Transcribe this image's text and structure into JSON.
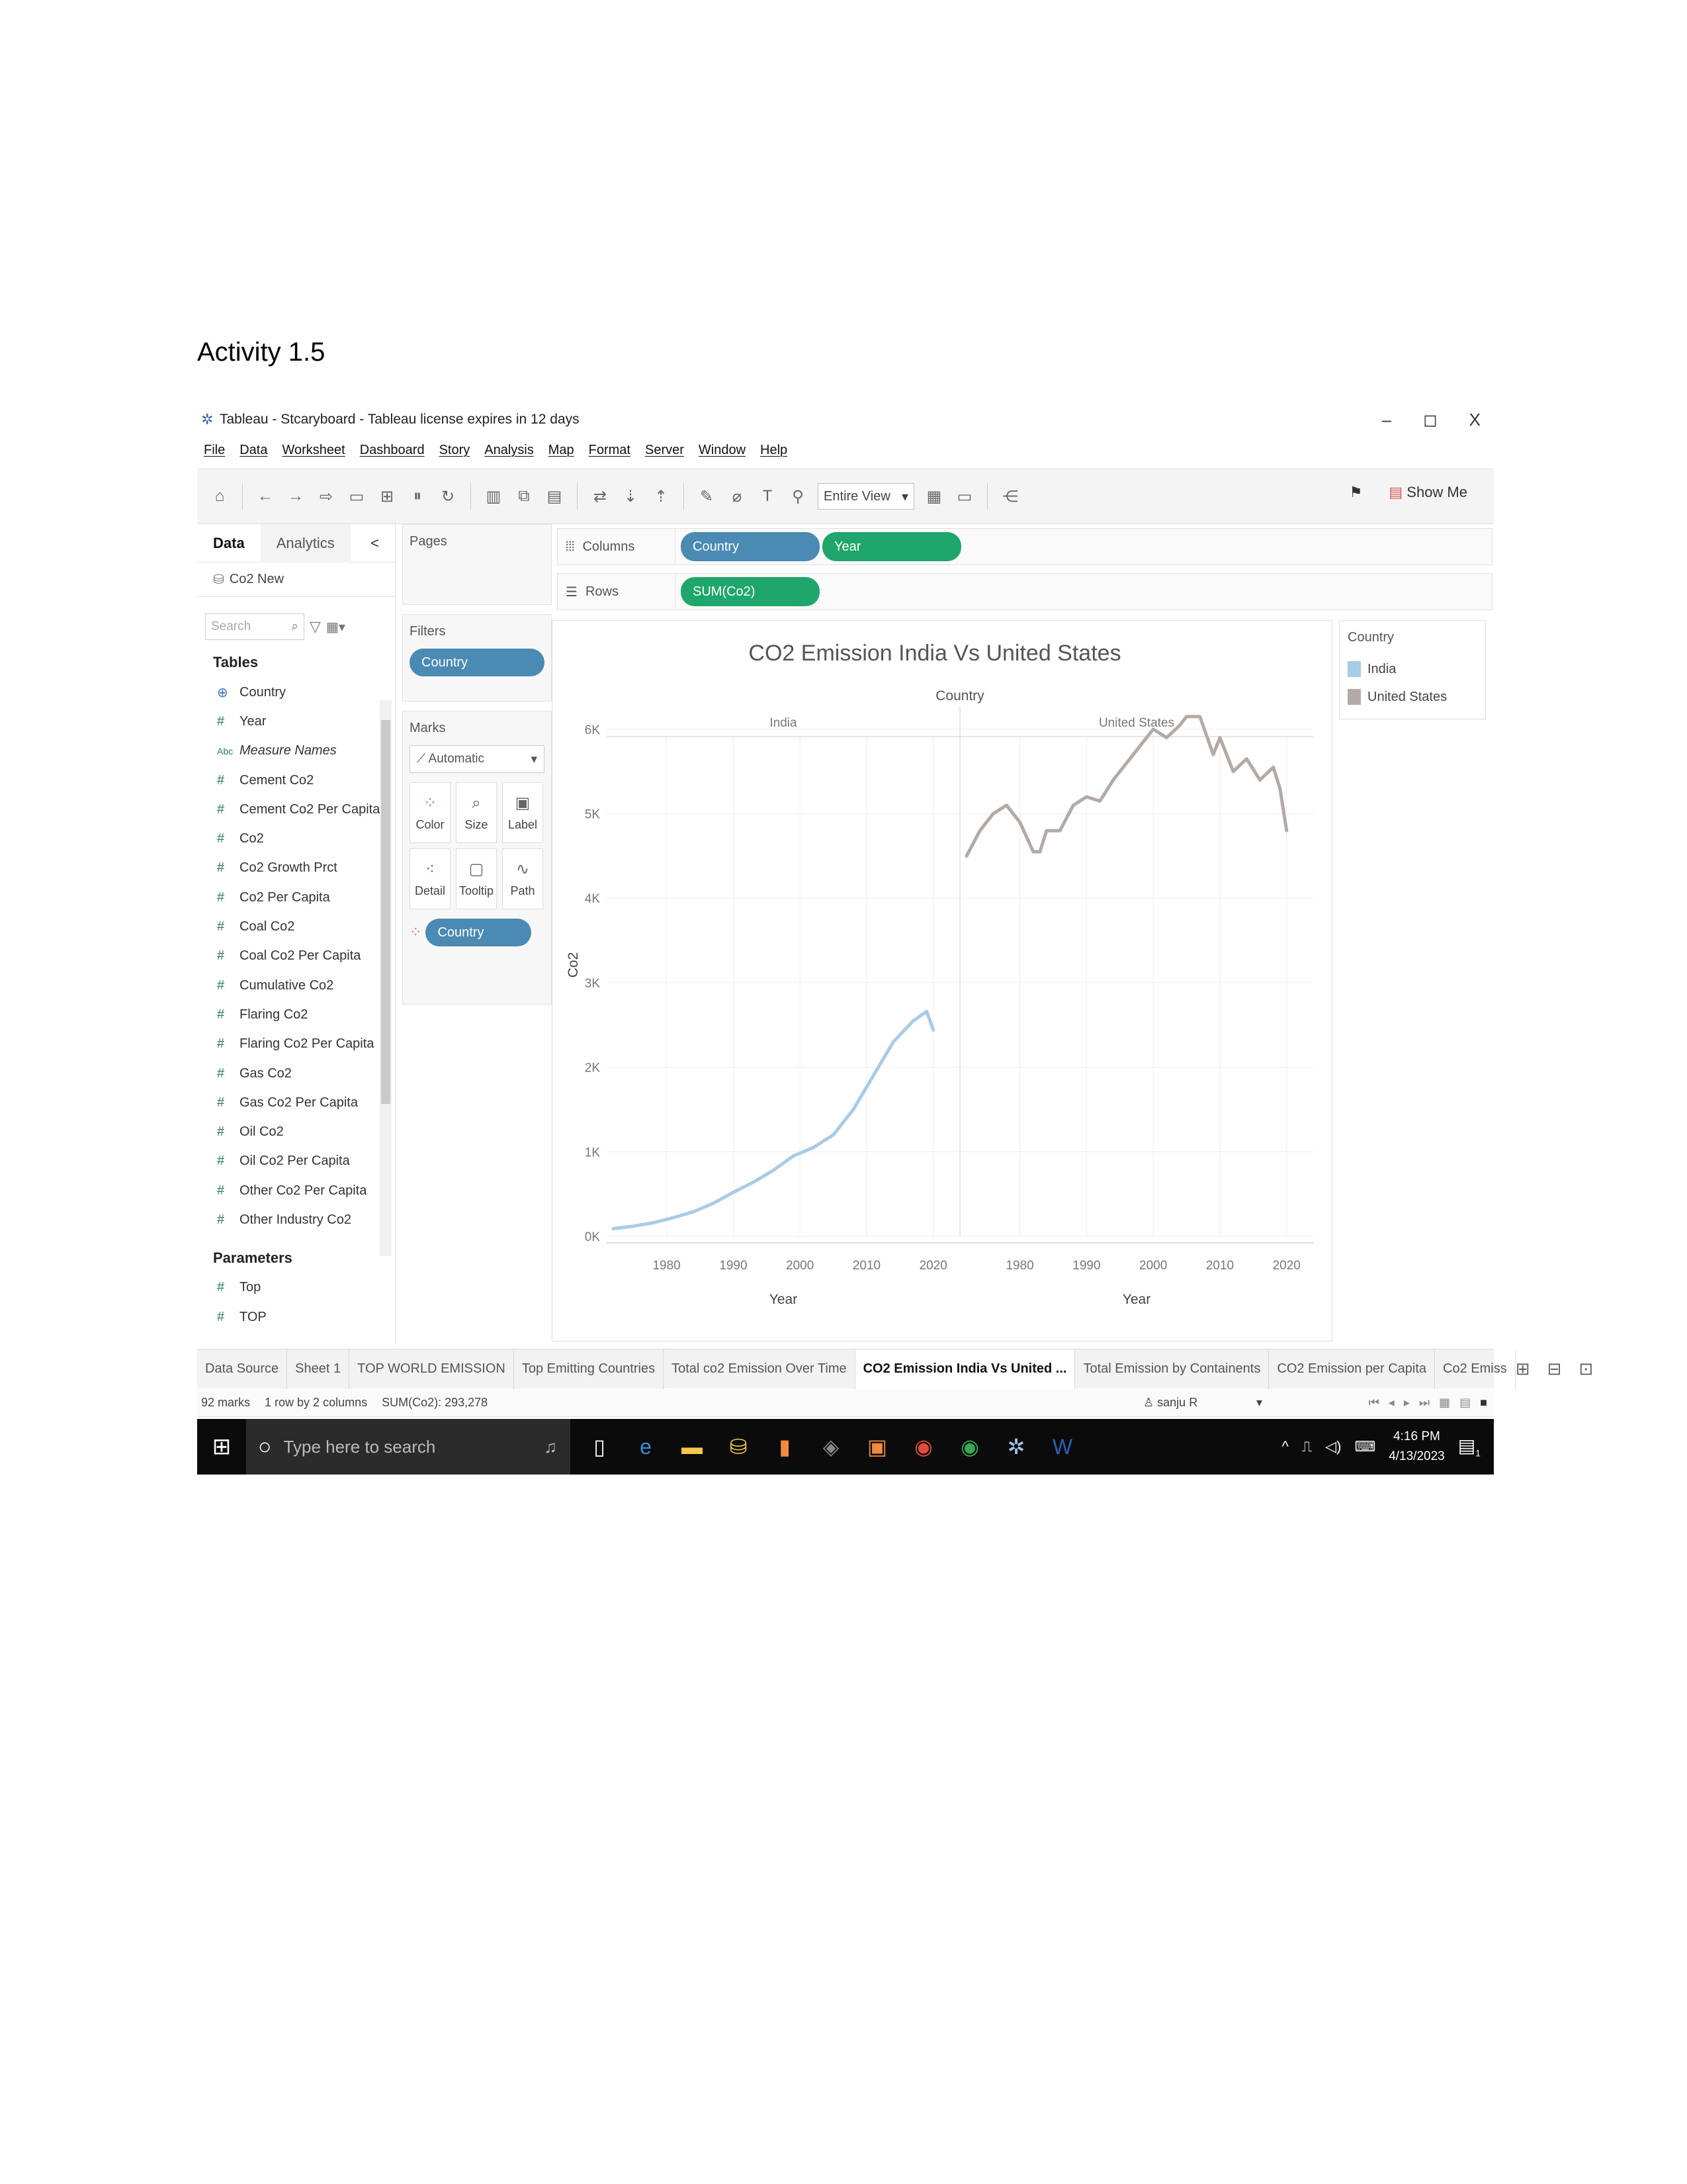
{
  "document": {
    "heading": "Activity 1.5"
  },
  "window": {
    "title": "Tableau - Stcaryboard - Tableau license expires in 12 days",
    "controls": [
      "–",
      "◻",
      "X"
    ]
  },
  "menu": [
    "File",
    "Data",
    "Worksheet",
    "Dashboard",
    "Story",
    "Analysis",
    "Map",
    "Format",
    "Server",
    "Window",
    "Help"
  ],
  "toolbar": {
    "view_select": "Entire View",
    "show_me": "Show Me"
  },
  "data_pane": {
    "tab_data": "Data",
    "tab_analytics": "Analytics",
    "collapse": "<",
    "datasource": "Co2 New",
    "search_placeholder": "Search",
    "tables_label": "Tables",
    "fields": [
      {
        "type": "⊕",
        "name": "Country"
      },
      {
        "type": "#",
        "name": "Year"
      },
      {
        "type": "Abc",
        "name": "Measure Names"
      },
      {
        "type": "#",
        "name": "Cement Co2"
      },
      {
        "type": "#",
        "name": "Cement Co2 Per Capita"
      },
      {
        "type": "#",
        "name": "Co2"
      },
      {
        "type": "#",
        "name": "Co2 Growth Prct"
      },
      {
        "type": "#",
        "name": "Co2 Per Capita"
      },
      {
        "type": "#",
        "name": "Coal Co2"
      },
      {
        "type": "#",
        "name": "Coal Co2 Per Capita"
      },
      {
        "type": "#",
        "name": "Cumulative Co2"
      },
      {
        "type": "#",
        "name": "Flaring Co2"
      },
      {
        "type": "#",
        "name": "Flaring Co2 Per Capita"
      },
      {
        "type": "#",
        "name": "Gas Co2"
      },
      {
        "type": "#",
        "name": "Gas Co2 Per Capita"
      },
      {
        "type": "#",
        "name": "Oil Co2"
      },
      {
        "type": "#",
        "name": "Oil Co2 Per Capita"
      },
      {
        "type": "#",
        "name": "Other Co2 Per Capita"
      },
      {
        "type": "#",
        "name": "Other Industry Co2"
      }
    ],
    "parameters_label": "Parameters",
    "parameters": [
      {
        "type": "#",
        "name": "Top"
      },
      {
        "type": "#",
        "name": "TOP"
      }
    ]
  },
  "cards": {
    "pages_label": "Pages",
    "filters_label": "Filters",
    "filter_pill": "Country",
    "marks_label": "Marks",
    "marks_type": "Automatic",
    "mark_buttons": [
      "Color",
      "Size",
      "Label",
      "Detail",
      "Tooltip",
      "Path"
    ],
    "marks_pill": "Country"
  },
  "shelves": {
    "columns_label": "Columns",
    "columns_pills": [
      "Country",
      "Year"
    ],
    "rows_label": "Rows",
    "rows_pills": [
      "SUM(Co2)"
    ]
  },
  "chart_data": {
    "type": "line",
    "title": "CO2 Emission India Vs United States",
    "column_header": "Country",
    "panels": [
      "India",
      "United States"
    ],
    "xlabel": "Year",
    "ylabel": "Co2",
    "x_ticks": [
      1980,
      1990,
      2000,
      2010,
      2020
    ],
    "y_ticks": [
      "0K",
      "1K",
      "2K",
      "3K",
      "4K",
      "5K",
      "6K"
    ],
    "xlim": [
      1972,
      2023
    ],
    "ylim": [
      0,
      6500
    ],
    "grid": true,
    "series": [
      {
        "name": "India",
        "color": "#a8cbe6",
        "x": [
          1972,
          1975,
          1978,
          1981,
          1984,
          1987,
          1990,
          1993,
          1996,
          1999,
          2002,
          2005,
          2008,
          2011,
          2014,
          2017,
          2019,
          2020
        ],
        "y": [
          90,
          120,
          160,
          220,
          290,
          390,
          520,
          640,
          780,
          950,
          1050,
          1200,
          1500,
          1900,
          2300,
          2550,
          2660,
          2440
        ]
      },
      {
        "name": "United States",
        "color": "#b3aaa5",
        "x": [
          1972,
          1974,
          1976,
          1978,
          1980,
          1982,
          1983,
          1984,
          1986,
          1988,
          1990,
          1992,
          1994,
          1996,
          1998,
          2000,
          2002,
          2004,
          2005,
          2007,
          2009,
          2010,
          2012,
          2014,
          2016,
          2018,
          2019,
          2020
        ],
        "y": [
          4500,
          4800,
          5000,
          5100,
          4900,
          4550,
          4550,
          4800,
          4800,
          5100,
          5200,
          5150,
          5400,
          5600,
          5800,
          6000,
          5900,
          6050,
          6150,
          6150,
          5700,
          5900,
          5500,
          5650,
          5400,
          5550,
          5300,
          4800
        ]
      }
    ],
    "legend": {
      "title": "Country",
      "position": "right",
      "items": [
        "India",
        "United States"
      ]
    }
  },
  "sheet_tabs": [
    "Data Source",
    "Sheet 1",
    "TOP WORLD EMISSION",
    "Top Emitting Countries",
    "Total co2 Emission Over Time",
    "CO2 Emission India Vs United ...",
    "Total Emission by Containents",
    "CO2 Emission per Capita",
    "Co2 Emiss"
  ],
  "active_sheet_index": 5,
  "status": {
    "marks": "92 marks",
    "rows": "1 row by 2 columns",
    "sum": "SUM(Co2): 293,278",
    "user": "sanju R"
  },
  "taskbar": {
    "search_placeholder": "Type here to search",
    "time": "4:16 PM",
    "date": "4/13/2023",
    "notification_count": "1"
  }
}
